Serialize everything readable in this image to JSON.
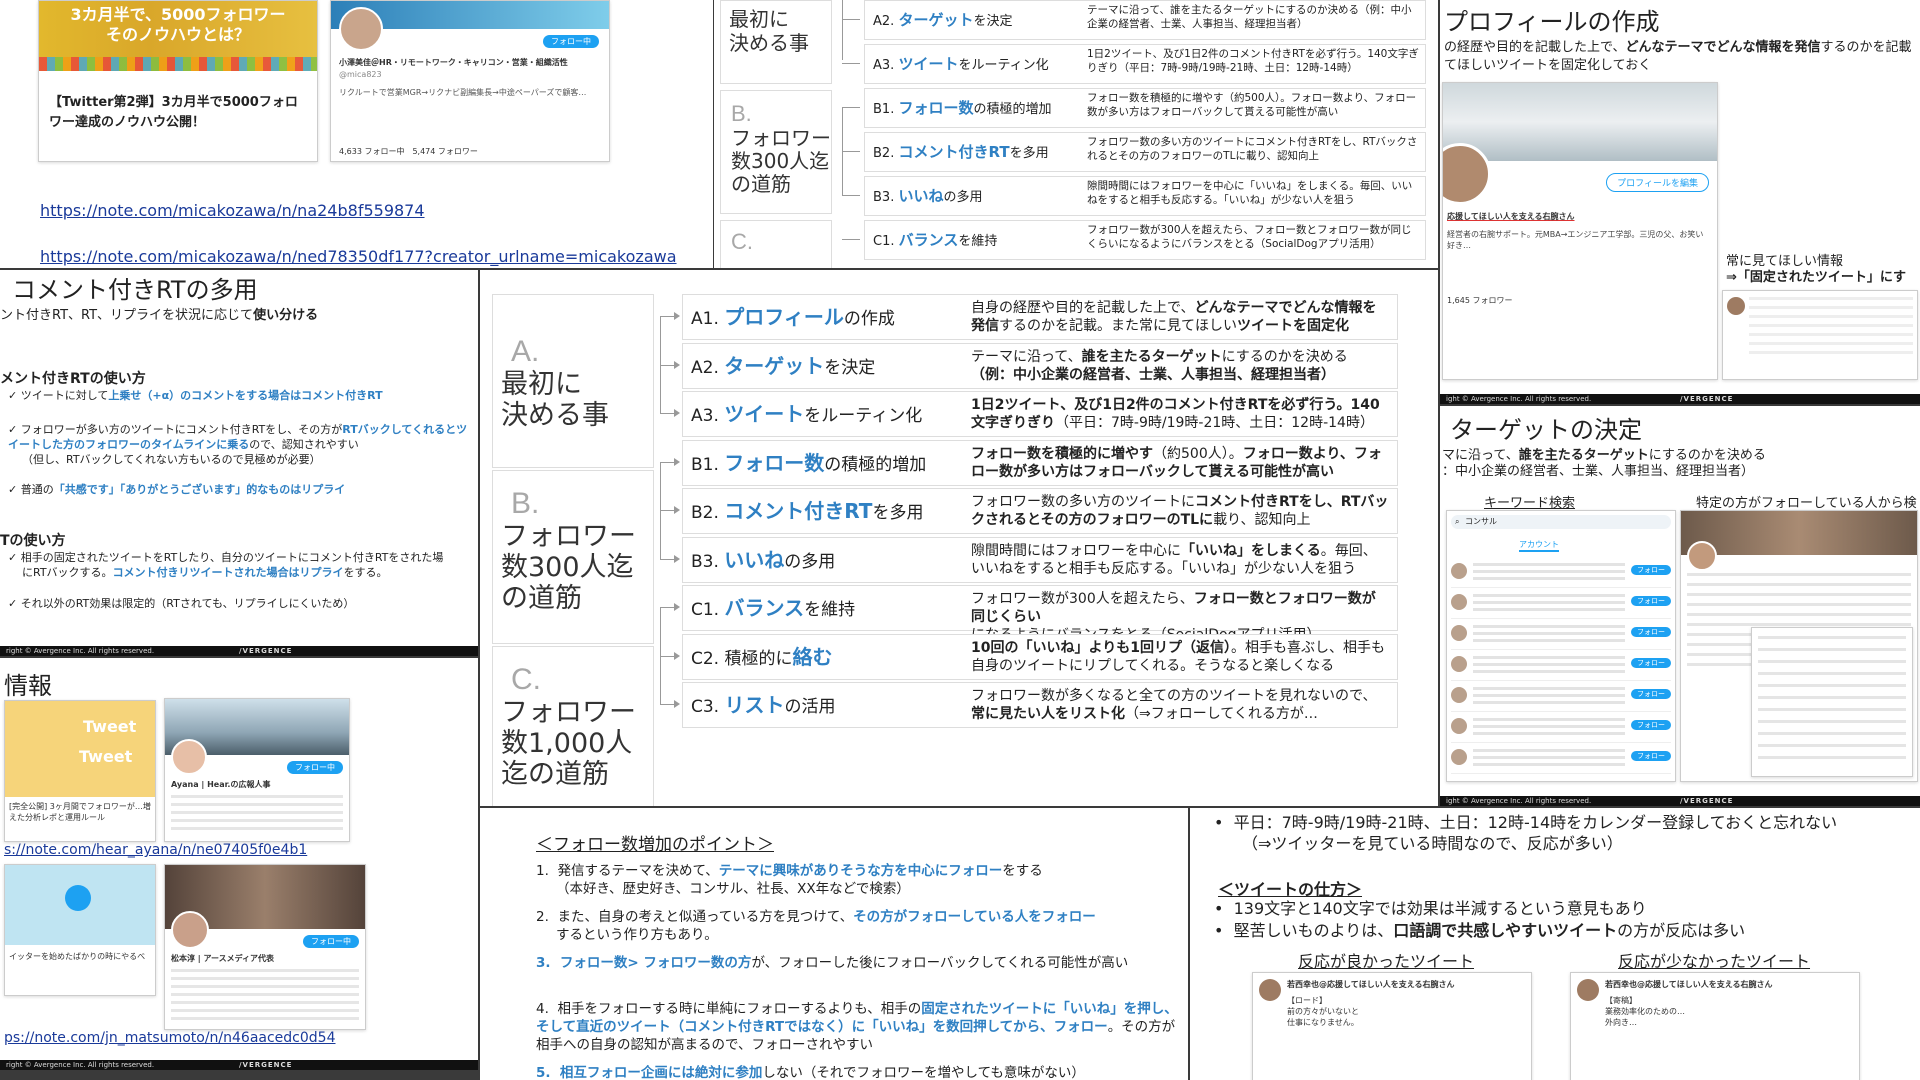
{
  "panel_note1": {
    "banner_text": "3カ月半で、5000フォロワー\nそのノウハウとは？",
    "article_title": "【Twitter第2弾】3カ月半で5000フォロワー達成のノウハウ公開！",
    "profile_name": "小澤美佳＠HR・リモートワーク・キャリコン・営業・組織活性",
    "profile_handle": "@mica823",
    "follow_label": "フォロー中",
    "profile_bio": "リクルートで営業MGR→リクナビ副編集長→中途ペーパーズで顧客…",
    "stats": "4,633 フォロー中　5,474 フォロワー",
    "url1": "https://note.com/micakozawa/n/na24b8f559874",
    "url2": "https://note.com/micakozawa/n/ned78350df177?creator_urlname=micakozawa"
  },
  "framework_small": {
    "rows": [
      {
        "code": "A2.",
        "kw": "ターゲット",
        "tail": "を決定",
        "desc": "テーマに沿って、誰を主たるターゲットにするのか決める（例：中小企業の経営者、士業、人事担当、経理担当者）"
      },
      {
        "code": "A3.",
        "kw": "ツイート",
        "tail": "をルーティン化",
        "desc": "1日2ツイート、及び1日2件のコメント付きRTを必ず行う。140文字ぎりぎり（平日：7時-9時/19時-21時、土日：12時-14時）"
      },
      {
        "code": "B1.",
        "kw": "フォロー数",
        "tail": "の積極的増加",
        "desc": "フォロー数を積極的に増やす（約500人）。フォロー数より、フォロー数が多い方はフォローバックして貰える可能性が高い"
      },
      {
        "code": "B2.",
        "kw": "コメント付きRT",
        "tail": "を多用",
        "desc": "フォロワー数の多い方のツイートにコメント付きRTをし、RTバックされるとその方のフォロワーのTLに載り、認知向上"
      },
      {
        "code": "B3.",
        "kw": "いいね",
        "tail": "の多用",
        "desc": "隙間時間にはフォロワーを中心に「いいね」をしまくる。毎回、いいねをすると相手も反応する。「いいね」が少ない人を狙う"
      },
      {
        "code": "C1.",
        "kw": "バランス",
        "tail": "を維持",
        "desc": "フォロワー数が300人を超えたら、フォロー数とフォロワー数が同じくらいになるようにバランスをとる（SocialDogアプリ活用）"
      }
    ],
    "phase_a_letter": "",
    "phase_a_title": "最初に\n決める事",
    "phase_b_letter": "B.",
    "phase_b_title": "フォロワー\n数300人迄\nの道筋",
    "phase_c_letter": "C."
  },
  "panel_profile": {
    "title": "プロフィールの作成",
    "intro_prefix": "の経歴や目的を記載した上で、",
    "intro_bold": "どんなテーマでどんな情報を発信",
    "intro_suffix": "するのかを記載",
    "intro2": "てほしいツイートを固定化しておく",
    "edit_button": "プロフィールを編集",
    "bio_head": "応援してほしい人を支える右腕さん",
    "bio_text": "経営者の右腕サポート。元MBA→エンジニア工学部。三児の父、お笑い好き…",
    "callout_line1": "常に見てほしい情報",
    "callout_line2": "⇒「固定されたツイート」にす",
    "followers": "1,645 フォロワー",
    "copyright": "ight © Avergence Inc. All rights reserved.",
    "brand": "/VERGENCE"
  },
  "panel_rt": {
    "title": "コメント付きRTの多用",
    "subtitle_prefix": "ント付きRT、RT、リプライを状況に応じて",
    "subtitle_bold": "使い分ける",
    "h1": "メント付きRTの使い方",
    "b1_prefix": "ツイートに対して",
    "b1_kw": "上乗せ（+α）のコメントをする場合はコメント付きRT",
    "b2_prefix": "フォロワーが多い方のツイートにコメント付きRTをし、その方が",
    "b2_kw": "RTバックしてくれるとツイートした方のフォロワーのタイムラインに乗る",
    "b2_suffix": "ので、認知されやすい",
    "b2_note": "（但し、RTバックしてくれない方もいるので見極めが必要）",
    "b3_prefix": "普通の",
    "b3_kw": "「共感です」「ありがとうございます」的なものはリプライ",
    "h2": "Tの使い方",
    "c1_prefix": "相手の固定されたツイートをRTしたり、自分のツイートにコメント付きRTをされた場",
    "c1_line2": "にRTバックする。",
    "c1_kw": "コメント付きリツイートされた場合はリプライ",
    "c1_suffix": "をする。",
    "c2": "それ以外のRT効果は限定的（RTされても、リプライしにくいため）",
    "copyright": "right © Avergence Inc. All rights reserved.",
    "brand": "/VERGENCE"
  },
  "framework_main": {
    "phase_a_letter": "A.",
    "phase_a_title": "最初に\n決める事",
    "phase_b_letter": "B.",
    "phase_b_title": "フォロワー\n数300人迄\nの道筋",
    "phase_c_letter": "C.",
    "phase_c_title": "フォロワー\n数1,000人\n迄の道筋",
    "rows": [
      {
        "code": "A1.",
        "kw": "プロフィール",
        "tail": "の作成",
        "desc_a": "自身の経歴や目的を記載した上で、",
        "desc_b": "どんなテーマでどんな情報を発信",
        "desc_c": "するのかを記載。また常に見てほしい",
        "desc_d": "ツイートを固定化"
      },
      {
        "code": "A2.",
        "kw": "ターゲット",
        "tail": "を決定",
        "desc_a": "テーマに沿って、",
        "desc_b": "誰を主たるターゲット",
        "desc_c": "にするのかを決める",
        "desc_d": "（例：中小企業の経営者、士業、人事担当、経理担当者）"
      },
      {
        "code": "A3.",
        "kw": "ツイート",
        "tail": "をルーティン化",
        "desc_a": "",
        "desc_b": "1日2ツイート、及び1日2件のコメント付きRTを必ず行う。140文字ぎりぎり",
        "desc_c": "（平日：7時-9時/19時-21時、土日：12時-14時）",
        "desc_d": ""
      },
      {
        "code": "B1.",
        "kw": "フォロー数",
        "tail": "の積極的増加",
        "desc_a": "",
        "desc_b": "フォロー数を積極的に増やす",
        "desc_c": "（約500人）。",
        "desc_d": "フォロー数より、フォロー数が多い方はフォローバックして貰える可能性が高い"
      },
      {
        "code": "B2.",
        "kw": "コメント付きRT",
        "tail": "を多用",
        "desc_a": "フォロワー数の多い方のツイートに",
        "desc_b": "コメント付きRTをし、RTバックされるとその方のフォロワーのTLに",
        "desc_c": "載り、認知向上",
        "desc_d": ""
      },
      {
        "code": "B3.",
        "kw": "いいね",
        "tail": "の多用",
        "desc_a": "隙間時間にはフォロワーを中心に",
        "desc_b": "「いいね」をしまくる",
        "desc_c": "。毎回、いいねをすると相手も反応する。「いいね」が少ない人を狙う",
        "desc_d": ""
      },
      {
        "code": "C1.",
        "kw": "バランス",
        "tail": "を維持",
        "desc_a": "フォロワー数が300人を超えたら、",
        "desc_b": "フォロー数とフォロワー数が同じくらい",
        "desc_c": "になるようにバランスをとる（SocialDogアプリ活用）",
        "desc_d": ""
      },
      {
        "code": "C2.",
        "kw": "絡む",
        "tail": "",
        "pre": "積極的に",
        "desc_a": "",
        "desc_b": "10回の「いいね」よりも1回リプ（返信）",
        "desc_c": "。相手も喜ぶし、相手も自身のツイートにリプしてくれる。そうなると楽しくなる",
        "desc_d": ""
      },
      {
        "code": "C3.",
        "kw": "リスト",
        "tail": "の活用",
        "desc_a": "フォロワー数が多くなると全ての方のツイートを見れないので、",
        "desc_b": "常に見たい人をリスト化",
        "desc_c": "（⇒フォローしてくれる方が…",
        "desc_d": ""
      }
    ]
  },
  "panel_target": {
    "title": "ターゲットの決定",
    "line1_prefix": "マに沿って、",
    "line1_bold": "誰を主たるターゲット",
    "line1_suffix": "にするのかを決める",
    "line2": "：中小企業の経営者、士業、人事担当、経理担当者）",
    "label_left": "キーワード検索",
    "label_right": "特定の方がフォローしている人から検",
    "search_text": "コンサル",
    "tab_account": "アカウント",
    "follow_label": "フォロー",
    "copyright": "ight © Avergence Inc. All rights reserved.",
    "brand": "/VERGENCE"
  },
  "panel_info": {
    "title": "情報",
    "tweet_word1": "Tweet",
    "tweet_word2": "Tweet",
    "author1": "Ayana | Hear.の広報人事",
    "article1": "[完全公開] 3ヶ月間でフォロワーが…増えた分析レポと運用ルール",
    "url1": "s://note.com/hear_ayana/n/ne07405f0e4b1",
    "article2": "イッターを始めたばかりの時にやるべ",
    "author2": "松本淳 | アースメディア代表",
    "url2": "ps://note.com/jn_matsumoto/n/n46aacedc0d54",
    "follow_label": "フォロー中",
    "copyright": "right © Avergence Inc. All rights reserved.",
    "brand": "/VERGENCE"
  },
  "panel_points": {
    "title": "＜フォロー数増加のポイント＞",
    "p1_prefix": "発信するテーマを決めて、",
    "p1_kw": "テーマに興味がありそうな方を中心にフォロー",
    "p1_suffix": "をする",
    "p1_note": "（本好き、歴史好き、コンサル、社長、XX年などで検索）",
    "p2_prefix": "また、自身の考えと似通っている方を見つけて、",
    "p2_kw": "その方がフォローしている人をフォロー",
    "p2_suffix": "するという作り方もあり。",
    "p3_kw": "フォロー数> フォロワー数の方",
    "p3_suffix": "が、フォローした後にフォローバックしてくれる可能性が高い",
    "p4_prefix": "相手をフォローする時に単純にフォローするよりも、相手の",
    "p4_kw": "固定されたツイートに「いいね」を押し、そして直近のツイート（コメント付きRTではなく）に「いいね」を数回押してから、フォロー",
    "p4_suffix": "。その方が相手への自身の認知が高まるので、フォローされやすい",
    "p5_kw": "相互フォロー企画には絶対に参加",
    "p5_suffix": "しない（それでフォロワーを増やしても意味がない）"
  },
  "panel_tweets": {
    "bullet1": "平日：7時-9時/19時-21時、土日：12時-14時をカレンダー登録しておくと忘れない",
    "bullet1_note": "（⇒ツイッターを見ている時間なので、反応が多い）",
    "heading": "＜ツイートの仕方＞",
    "bullet2": "139文字と140文字では効果は半減するという意見もあり",
    "bullet3_prefix": "堅苦しいものよりは、",
    "bullet3_bold": "口語調で共感しやすいツイート",
    "bullet3_suffix": "の方が反応は多い",
    "good_label": "反応が良かったツイート",
    "bad_label": "反応が少なかったツイート",
    "tweet_author": "若西幸也@応援してほしい人を支える右腕さん",
    "tweet_good": "【ロード】\n前の方々がいないと\n仕事になりません。",
    "tweet_bad": "【寄稿】\n業務効率化のための…\n外向き…"
  }
}
